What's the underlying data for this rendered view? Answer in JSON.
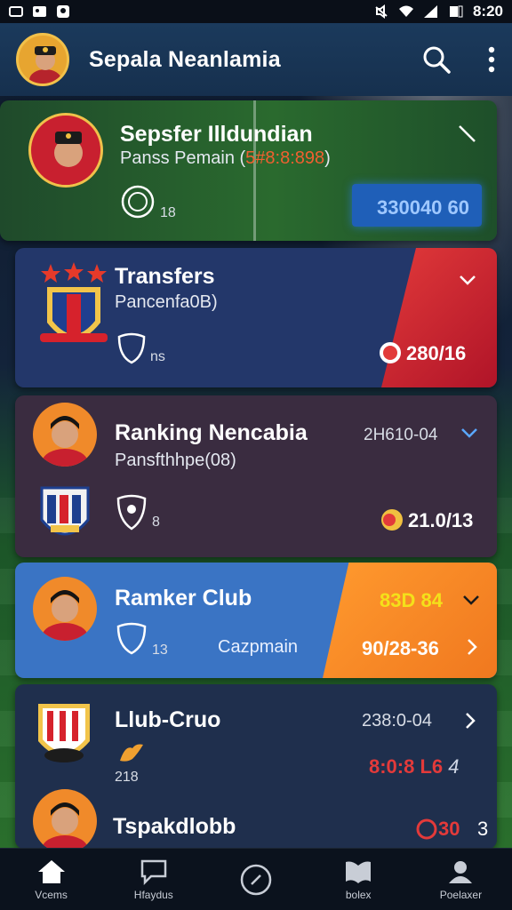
{
  "status_bar": {
    "time": "8:20"
  },
  "app_bar": {
    "title": "Sepala Neanlamia"
  },
  "cards": [
    {
      "name": "Sepsfer Illdundian",
      "sub": "Panss Pemain (",
      "sub_highlight": "5#8:8:898",
      "sub_end": ")",
      "meta": "18",
      "score": "330040 60"
    },
    {
      "name": "Transfers",
      "sub": "Pancenfa0B)",
      "meta": "ns",
      "score": "280/16"
    },
    {
      "name": "Ranking Nencabia",
      "date": "2H610-04",
      "sub": "Pansfthhpe(08)",
      "meta": "8",
      "score": "21.0/13"
    },
    {
      "name": "Ramker Club",
      "highlight": "83D 84",
      "meta": "13",
      "club": "Cazpmain",
      "score": "90/28-36"
    },
    {
      "name": "Llub-Cruo",
      "date": "238:0-04",
      "meta": "218",
      "score": "8:0:8 L6",
      "score_suffix": "4",
      "name2": "Tspakdlobb",
      "score2": "30",
      "score2_suffix": "3"
    }
  ],
  "nav": [
    {
      "label": "Vcems",
      "icon": "home-icon"
    },
    {
      "label": "Hfaydus",
      "icon": "chat-icon"
    },
    {
      "label": "",
      "icon": "compass-icon"
    },
    {
      "label": "bolex",
      "icon": "book-icon"
    },
    {
      "label": "Poelaxer",
      "icon": "profile-icon"
    }
  ],
  "colors": {
    "accent_blue": "#3a74c4",
    "accent_orange": "#f6922a",
    "accent_red": "#c8202f",
    "score_blue": "#2d5fd0"
  }
}
